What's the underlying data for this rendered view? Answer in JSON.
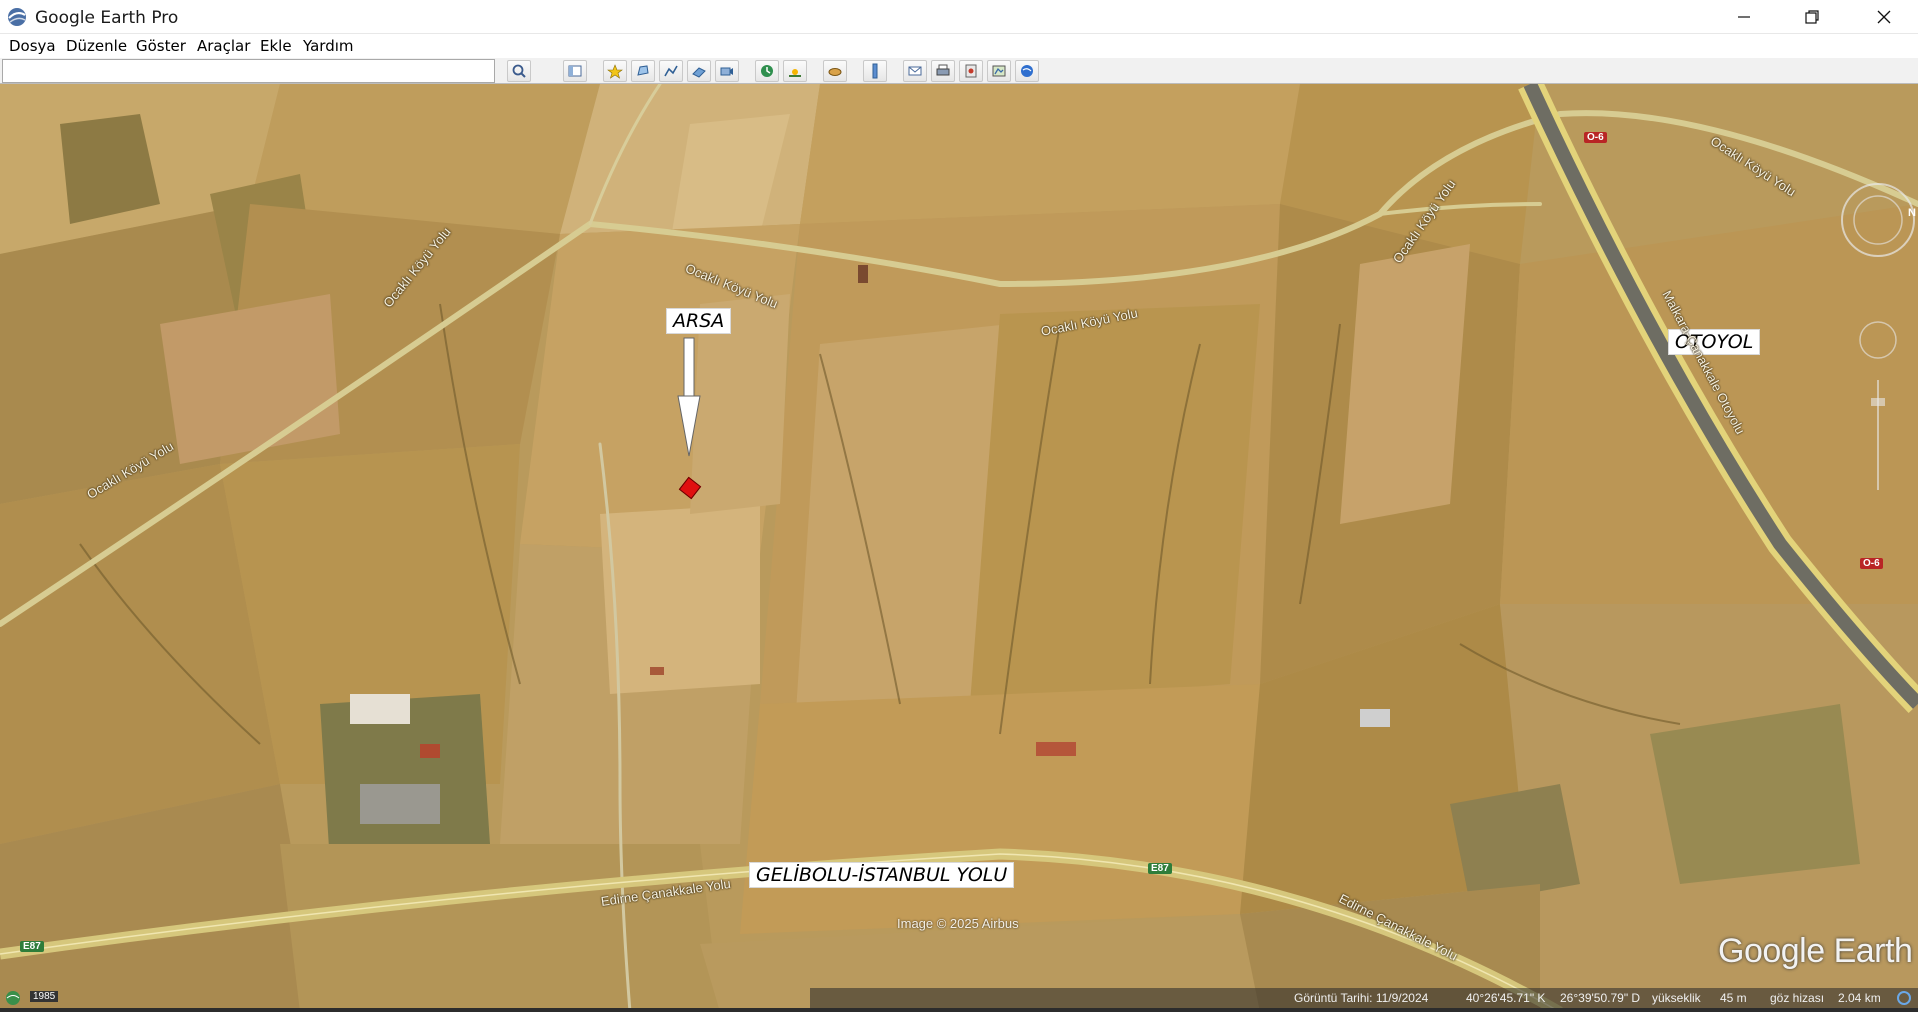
{
  "window": {
    "title": "Google Earth Pro"
  },
  "menu": [
    {
      "label": "Dosya"
    },
    {
      "label": "Düzenle"
    },
    {
      "label": "Göster"
    },
    {
      "label": "Araçlar"
    },
    {
      "label": "Ekle"
    },
    {
      "label": "Yardım"
    }
  ],
  "search": {
    "value": "",
    "placeholder": ""
  },
  "toolbar_icons": [
    "search-icon",
    "sidebar-toggle-icon",
    "add-placemark-icon",
    "add-polygon-icon",
    "add-path-icon",
    "add-image-overlay-icon",
    "record-tour-icon",
    "historical-imagery-icon",
    "sunlight-icon",
    "planets-icon",
    "ruler-icon",
    "email-icon",
    "print-icon",
    "save-image-icon",
    "view-in-maps-icon",
    "google-earth-icon"
  ],
  "map": {
    "labels": {
      "arsa": "ARSA",
      "otoyol": "OTOYOL",
      "gelibolu": "GELİBOLU-İSTANBUL YOLU"
    },
    "roads": {
      "ocakli_1": "Ocaklı Köyü Yolu",
      "ocakli_2": "Ocaklı Köyü Yolu",
      "ocakli_3": "Ocaklı Köyü Yolu",
      "ocakli_4": "Ocaklı Köyü Yolu",
      "ocakli_5": "Ocaklı Köyü Yolu",
      "ocakli_6": "Ocaklı Köyü Yolu",
      "edirne_1": "Edirne Çanakkale Yolu",
      "edirne_2": "Edirne Çanakkale Yolu",
      "otoyol_name": "Malkara-Çanakkale Otoyolu"
    },
    "shields": {
      "o6_top": "O-6",
      "o6_right": "O-6",
      "e87_center": "E87",
      "e87_left": "E87"
    },
    "marker_color": "#e01010",
    "copyright": "Image © 2025 Airbus",
    "watermark": "Google Earth"
  },
  "status": {
    "year": "1985",
    "imagery_date": "Görüntü Tarihi: 11/9/2024",
    "lat": "40°26'45.71\" K",
    "lon": "26°39'50.79\" D",
    "elevation_label": "yükseklik",
    "elevation_value": "45 m",
    "eye_label": "göz hizası",
    "eye_value": "2.04 km"
  },
  "colors": {
    "field_base": "#b99a5c",
    "road": "#d7cc92",
    "motorway": "#e3d37a"
  }
}
